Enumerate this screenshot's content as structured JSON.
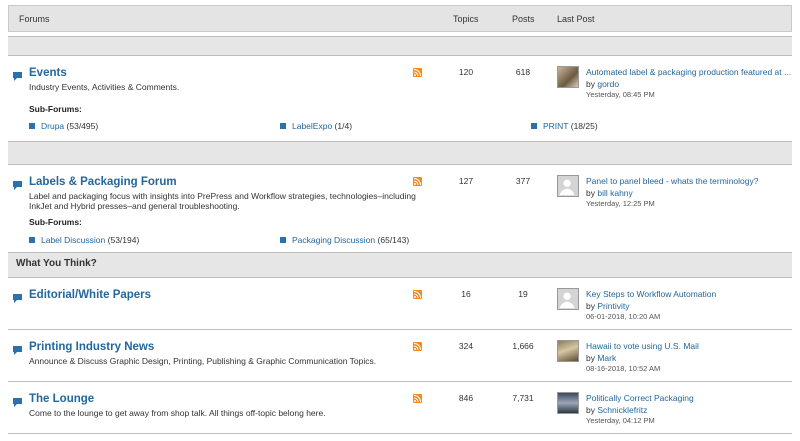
{
  "header": {
    "forums": "Forums",
    "topics": "Topics",
    "posts": "Posts",
    "last_post": "Last Post"
  },
  "sections": {
    "what_you_think": "What You Think?"
  },
  "forums": [
    {
      "title": "Events",
      "description": "Industry Events, Activities & Comments.",
      "topics": "120",
      "posts": "618",
      "subforums_label": "Sub-Forums:",
      "subforums": [
        {
          "label": "Drupa",
          "count": "(53/495)"
        },
        {
          "label": "LabelExpo",
          "count": "(1/4)"
        },
        {
          "label": "PRINT",
          "count": "(18/25)"
        }
      ],
      "last_post": {
        "title": "Automated label & packaging production featured at ...",
        "by": "by ",
        "user": "gordo",
        "time": "Yesterday, 08:45 PM"
      }
    },
    {
      "title": "Labels & Packaging Forum",
      "description": "Label and packaging focus with insights into PrePress and Workflow strategies, technologies–including InkJet and Hybrid presses–and general troubleshooting.",
      "topics": "127",
      "posts": "377",
      "subforums_label": "Sub-Forums:",
      "subforums": [
        {
          "label": "Label Discussion",
          "count": "(53/194)"
        },
        {
          "label": "Packaging Discussion",
          "count": "(65/143)"
        }
      ],
      "last_post": {
        "title": "Panel to panel bleed - whats the terminology?",
        "by": "by ",
        "user": "bill kahny",
        "time": "Yesterday, 12:25 PM"
      }
    },
    {
      "title": "Editorial/White Papers",
      "description": "",
      "topics": "16",
      "posts": "19",
      "last_post": {
        "title": "Key Steps to Workflow Automation",
        "by": "by ",
        "user": "Printivity",
        "time": "06-01-2018, 10:20 AM"
      }
    },
    {
      "title": "Printing Industry News",
      "description": "Announce & Discuss Graphic Design, Printing, Publishing & Graphic Communication Topics.",
      "topics": "324",
      "posts": "1,666",
      "last_post": {
        "title": "Hawaii to vote using U.S. Mail",
        "by": "by ",
        "user": "Mark",
        "time": "08-16-2018, 10:52 AM"
      }
    },
    {
      "title": "The Lounge",
      "description": "Come to the lounge to get away from shop talk. All things off-topic belong here.",
      "topics": "846",
      "posts": "7,731",
      "last_post": {
        "title": "Politically Correct Packaging",
        "by": "by ",
        "user": "Schnicklefritz",
        "time": "Yesterday, 04:12 PM"
      }
    }
  ],
  "colors": {
    "link": "#23679c",
    "band": "#e6e6e6",
    "rss": "#f08a24"
  }
}
